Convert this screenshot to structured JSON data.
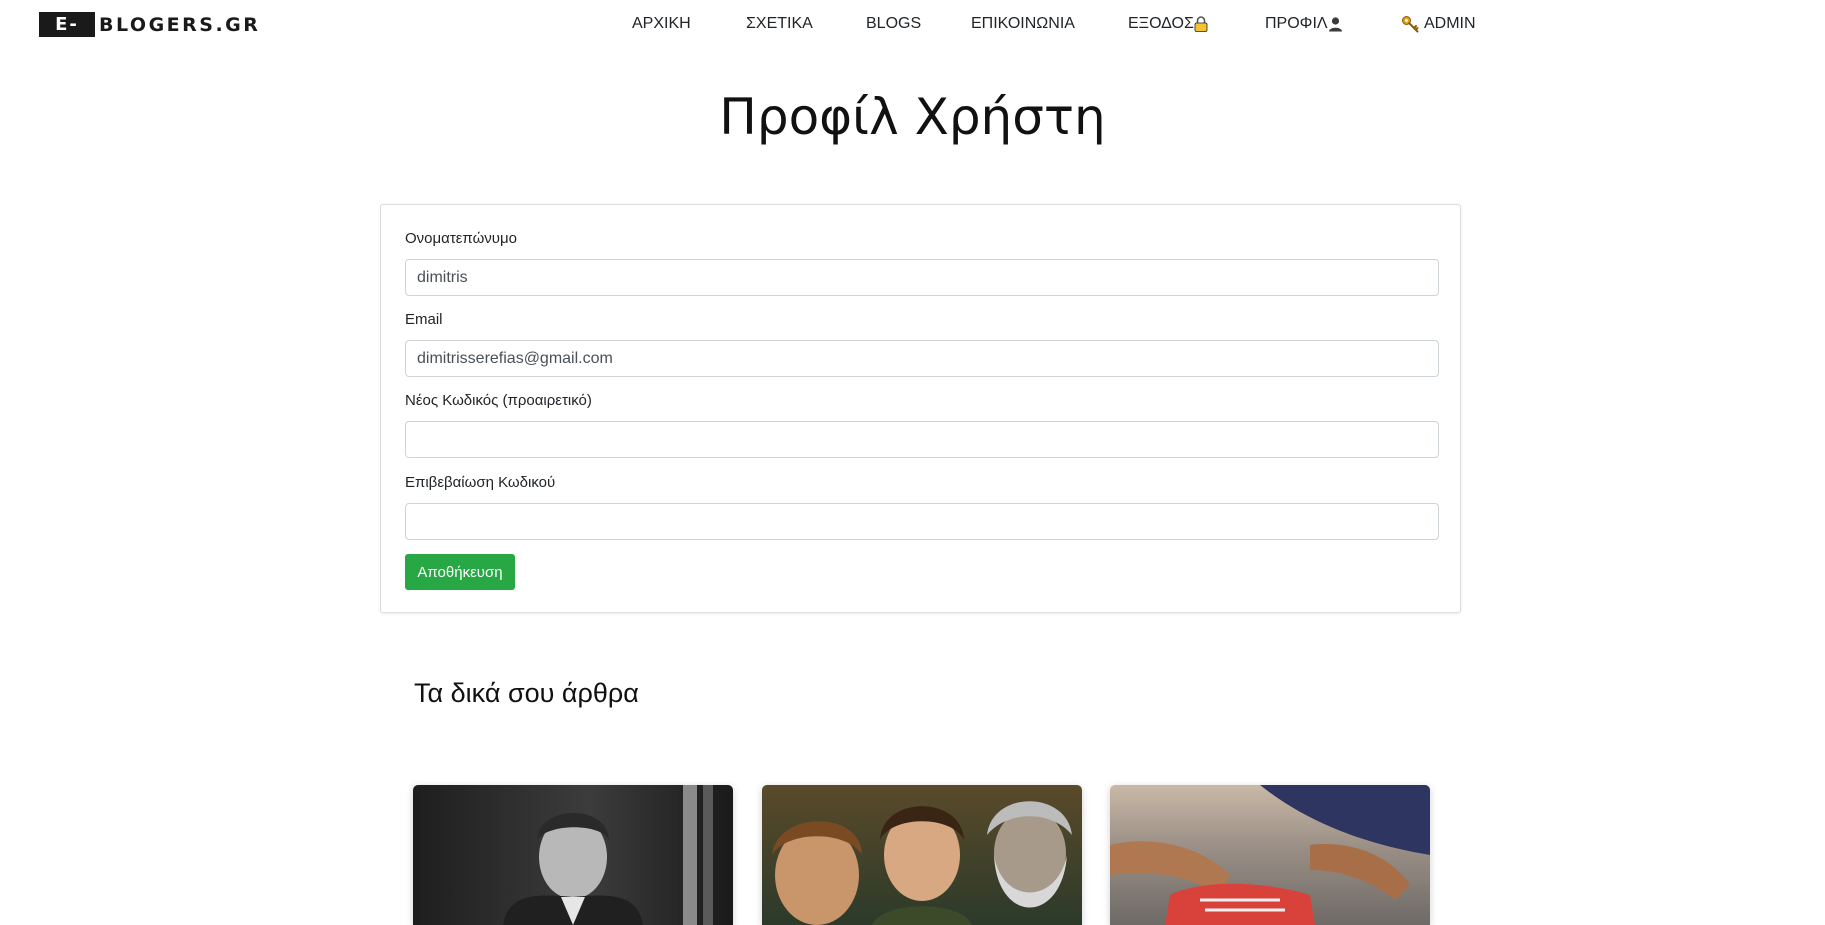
{
  "brand": {
    "box_text": "E-",
    "text": "BLOGERS.GR"
  },
  "nav": {
    "home": "ΑΡΧΙΚΗ",
    "about": "ΣΧΕΤΙΚΑ",
    "blogs": "BLOGS",
    "contact": "ΕΠΙΚΟΙΝΩΝΙΑ",
    "logout": "ΕΞΟΔΟΣ",
    "profile": "ΠΡΟΦΙΛ",
    "admin": "ADMIN"
  },
  "page": {
    "title": "Προφίλ Χρήστη"
  },
  "form": {
    "fullname_label": "Ονοματεπώνυμο",
    "fullname_value": "dimitris",
    "email_label": "Email",
    "email_value": "dimitrisserefias@gmail.com",
    "new_password_label": "Νέος Κωδικός (προαιρετικό)",
    "new_password_value": "",
    "confirm_password_label": "Επιβεβαίωση Κωδικού",
    "confirm_password_value": "",
    "save_label": "Αποθήκευση"
  },
  "articles": {
    "section_title": "Τα δικά σου άρθρα"
  },
  "colors": {
    "accent_green": "#28a745",
    "brand_dark": "#1a1a1a",
    "lock_yellow": "#f4c430"
  },
  "icons": {
    "logout": "lock-icon",
    "profile": "user-silhouette-icon",
    "admin": "key-icon"
  }
}
